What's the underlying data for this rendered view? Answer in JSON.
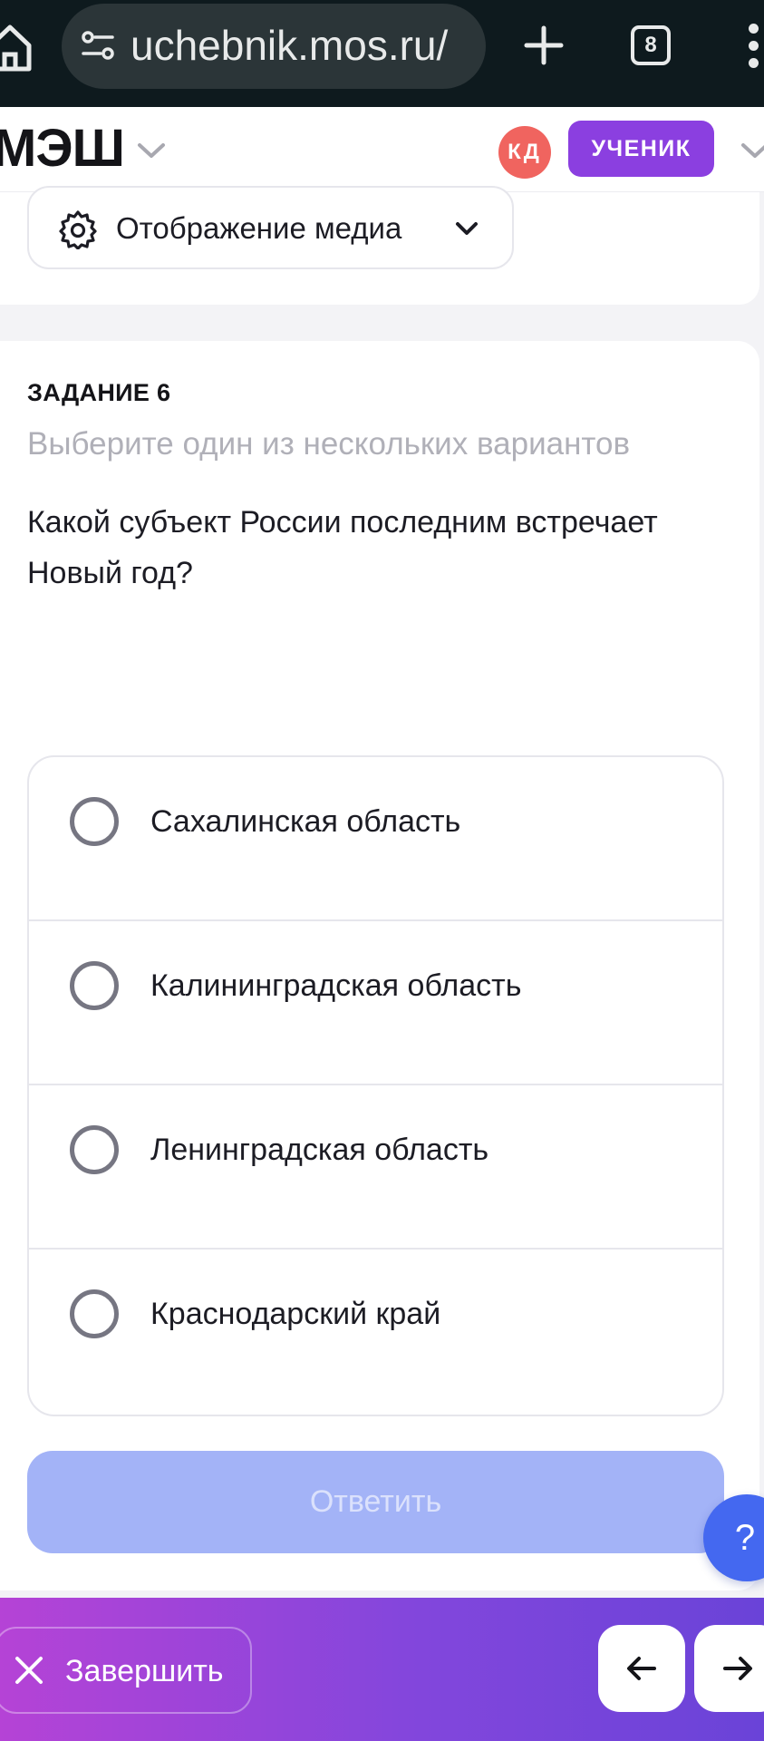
{
  "browser": {
    "url": "uchebnik.mos.ru/",
    "tabs_count": "8",
    "icons": [
      "home-icon",
      "site-settings-icon",
      "new-tab-icon",
      "tabs-icon",
      "menu-dots-icon"
    ]
  },
  "header": {
    "logo": "МЭШ",
    "avatar_initials": "КД",
    "role": "УЧЕНИК",
    "colors": {
      "avatar": "#f0645f",
      "role_badge": "#8b3fe0"
    }
  },
  "media": {
    "label": "Отображение медиа"
  },
  "task": {
    "number": "ЗАДАНИЕ 6",
    "hint": "Выберите один из нескольких вариантов",
    "question": "Какой субъект России последним встречает Новый год?",
    "options": [
      {
        "label": "Сахалинская область",
        "selected": false
      },
      {
        "label": "Калининградская область",
        "selected": false
      },
      {
        "label": "Ленинградская область",
        "selected": false
      },
      {
        "label": "Краснодарский край",
        "selected": false
      }
    ],
    "submit_label": "Ответить",
    "help_label": "?"
  },
  "footer": {
    "finish_label": "Завершить",
    "colors": {
      "gradient_start": "#b543d6",
      "gradient_end": "#6a43d8"
    }
  }
}
